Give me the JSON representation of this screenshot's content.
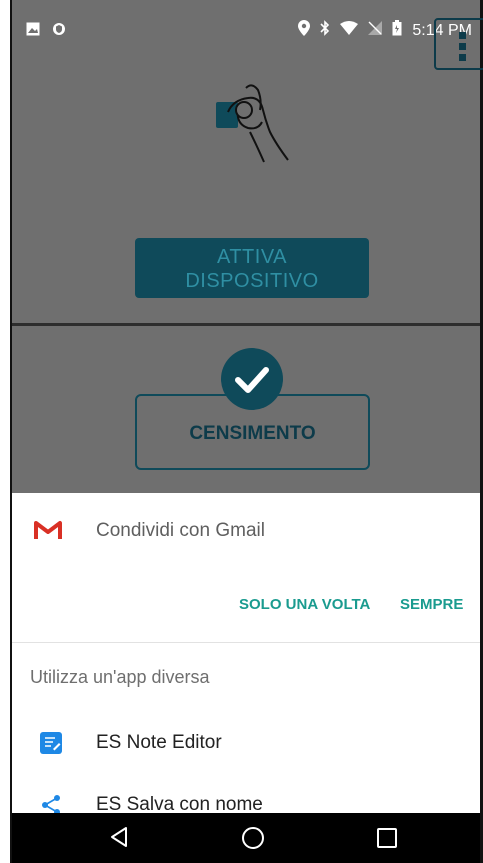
{
  "status_bar": {
    "time": "5:14 PM",
    "left_icons": [
      "image-icon",
      "shield-icon"
    ],
    "right_icons": [
      "location-icon",
      "bluetooth-icon",
      "wifi-icon",
      "no-signal-icon",
      "battery-icon"
    ]
  },
  "background_app": {
    "activate_button_label_line1": "ATTIVA",
    "activate_button_label_line2": "DISPOSITIVO",
    "census_button_label": "CENSIMENTO",
    "accent_color": "#0f4a5a"
  },
  "share_sheet": {
    "gmail_label": "Condividi con Gmail",
    "once_label": "SOLO UNA VOLTA",
    "always_label": "SEMPRE",
    "other_app_title": "Utilizza un'app diversa",
    "apps": [
      {
        "label": "ES Note Editor",
        "icon": "note-editor-icon"
      },
      {
        "label": "ES Salva con nome",
        "icon": "share-icon"
      }
    ],
    "action_color": "#1a9b8f"
  },
  "nav_bar": {
    "buttons": [
      "back-icon",
      "home-icon",
      "recents-icon"
    ]
  }
}
